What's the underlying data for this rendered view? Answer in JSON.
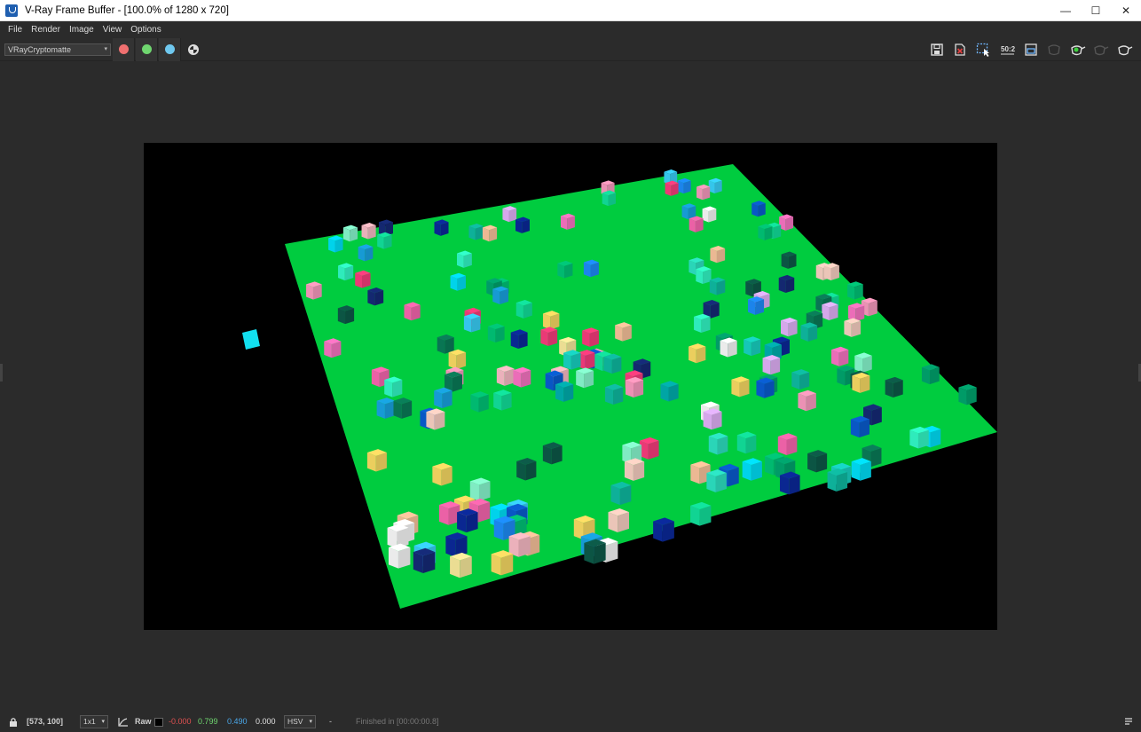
{
  "window": {
    "title": "V-Ray Frame Buffer - [100.0% of 1280 x 720]",
    "minimize_glyph": "—",
    "maximize_glyph": "☐",
    "close_glyph": "✕"
  },
  "menu": {
    "items": [
      "File",
      "Render",
      "Image",
      "View",
      "Options"
    ]
  },
  "toolbar": {
    "channel": "VRayCryptomatte",
    "channel_caret": "▾",
    "red_channel_color": "#f07070",
    "green_channel_color": "#6fd66f",
    "blue_channel_color": "#6fc8ef",
    "tools": [
      "save-icon",
      "clear-image-icon",
      "region-render-icon",
      "compare-50-icon",
      "lens-effects-icon",
      "stop-icon",
      "render-teapot-icon",
      "interactive-render-icon",
      "close-buffer-icon"
    ],
    "compare_label": "50:2"
  },
  "render": {
    "background_color": "#000000",
    "ground_color": "#00cc3f"
  },
  "status": {
    "coords": "[573, 100]",
    "zoom": "1x1",
    "zoom_caret": "▾",
    "mode": "Raw",
    "r_value": "-0.000",
    "g_value": "0.799",
    "b_value": "0.490",
    "a_value": "0.000",
    "color_space": "HSV",
    "color_space_caret": "▾",
    "dash": "-",
    "message": "Finished in [00:00:00.8]",
    "r_color": "#e05050",
    "g_color": "#6fd66f",
    "b_color": "#4aa7e8"
  }
}
